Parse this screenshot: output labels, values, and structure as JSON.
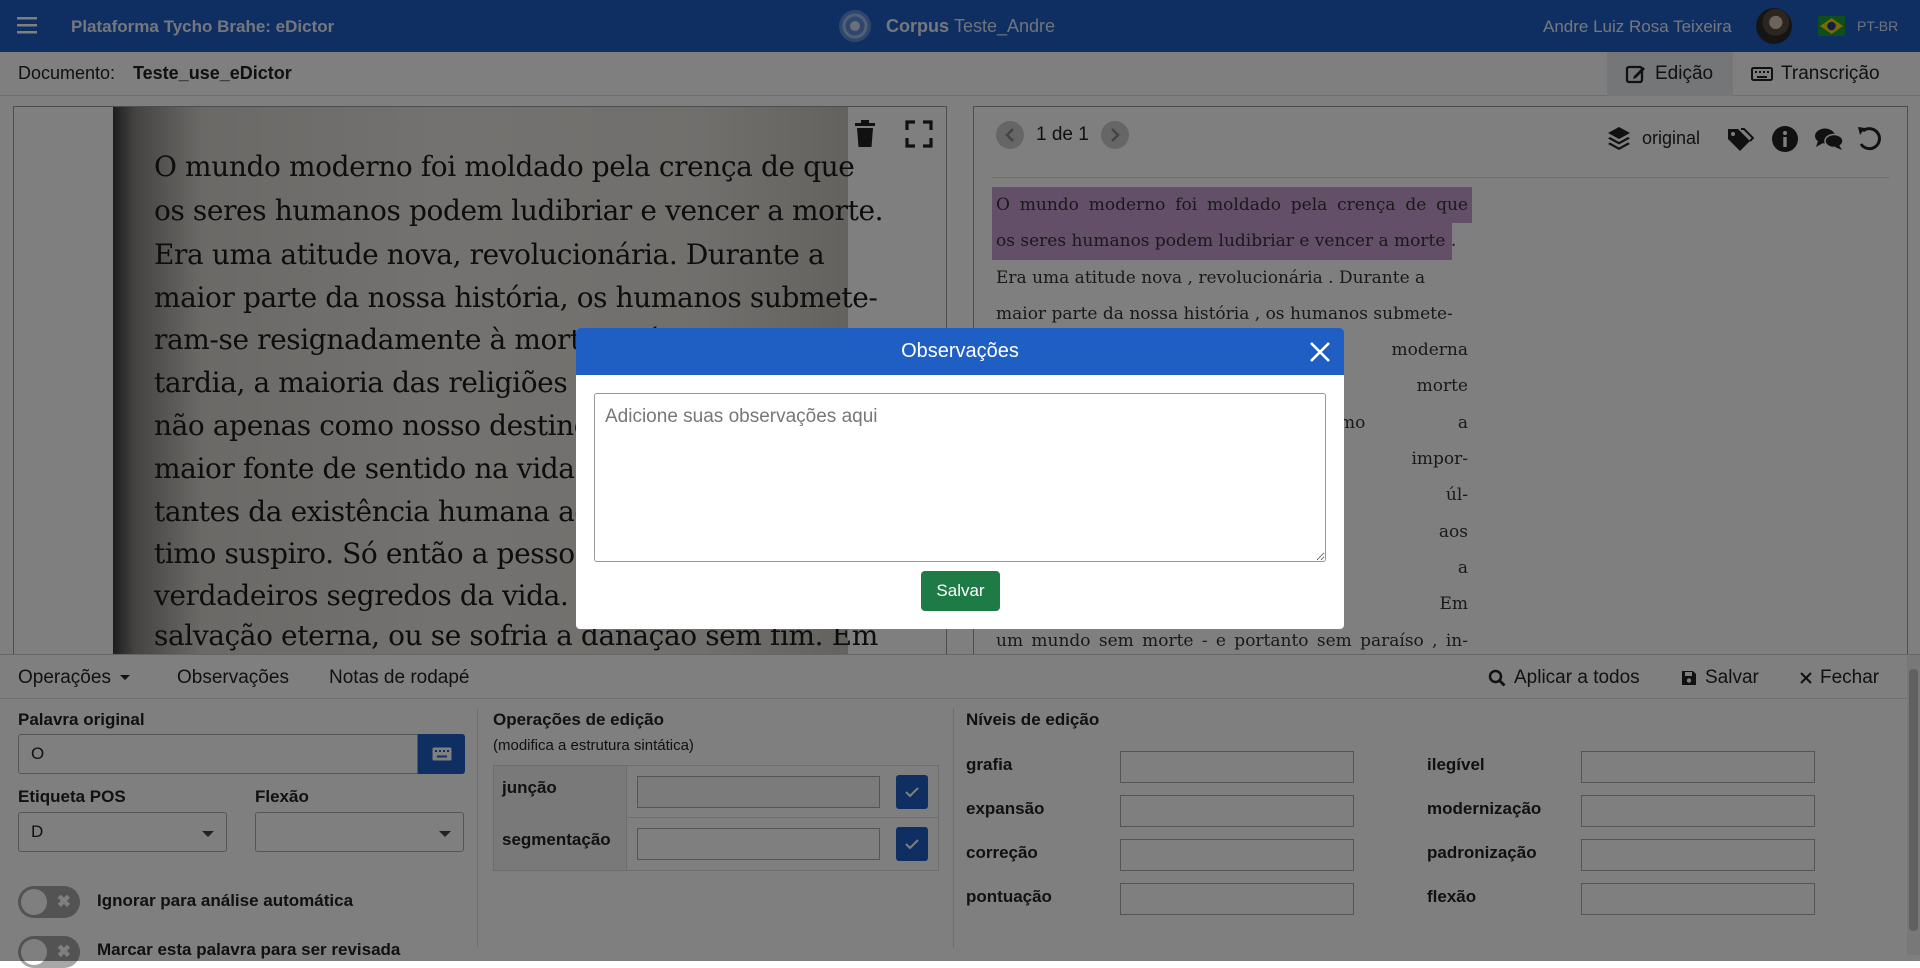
{
  "topbar": {
    "app_title": "Plataforma Tycho Brahe: eDictor",
    "corpus_label": "Corpus",
    "corpus_name": "Teste_Andre",
    "user_name": "Andre Luiz Rosa Teixeira",
    "language": "PT-BR",
    "colors": {
      "bar": "#1f5fc4",
      "flag": "#1c9b3a"
    }
  },
  "docbar": {
    "label": "Documento:",
    "doc_name": "Teste_use_eDictor",
    "tabs": [
      {
        "label": "Edição",
        "icon": "edit-icon",
        "active": true
      },
      {
        "label": "Transcrição",
        "icon": "keyboard-icon",
        "active": false
      }
    ]
  },
  "image_text": [
    "O mundo moderno foi moldado pela crença de que",
    "os seres humanos podem ludibriar e vencer a morte.",
    "Era uma atitude nova, revolucionária. Durante a",
    "maior parte da nossa história, os humanos submete-",
    "ram-se resignadamente à morte. Até",
    "tardia, a maioria das religiões e ideo",
    "não apenas como nosso destino inev",
    "maior fonte de sentido na vida. Os ev",
    "tantes da existência humana aconte",
    "timo suspiro. Só então a pessoa era",
    "verdadeiros segredos da vida. Só er",
    "salvação eterna, ou se sofria a danação sem fim. Em"
  ],
  "pager": {
    "text": "1 de 1"
  },
  "version_label": "original",
  "transcription": [
    "O mundo moderno foi moldado pela crença de que",
    "os seres humanos podem ludibriar e vencer a morte .",
    "Era uma atitude nova , revolucionária . Durante a",
    "maior parte da nossa história , os humanos submete-",
    "dade moderna",
    "as via a morte",
    "l , mas como a",
    "ntos mais impor-",
    "depois do úl-",
    "esentada aos",
    "se ganhava a",
    "sem fim . Em",
    "um mundo sem morte - e portanto sem paraíso , in-"
  ],
  "bottom_tabs": {
    "operations": "Operações",
    "observations": "Observações",
    "footnotes": "Notas de rodapé",
    "apply_all": "Aplicar a todos",
    "save": "Salvar",
    "close": "Fechar"
  },
  "word_panel": {
    "original_word_label": "Palavra original",
    "original_word_value": "O",
    "pos_label": "Etiqueta POS",
    "pos_value": "D",
    "inflection_label": "Flexão",
    "inflection_value": "",
    "ignore_label": "Ignorar para análise automática",
    "review_label": "Marcar esta palavra para ser revisada"
  },
  "edit_ops": {
    "title": "Operações de edição",
    "subtitle": "(modifica a estrutura sintática)",
    "rows": [
      "junção",
      "segmentação"
    ]
  },
  "levels": {
    "title": "Níveis de edição",
    "left": [
      "grafia",
      "expansão",
      "correção",
      "pontuação"
    ],
    "right": [
      "ilegível",
      "modernização",
      "padronização",
      "flexão"
    ]
  },
  "modal": {
    "title": "Observações",
    "placeholder": "Adicione suas observações aqui",
    "save": "Salvar",
    "colors": {
      "header": "#1f5fc4",
      "save": "#1e7b45"
    }
  },
  "highlight_color": "#c79fd0"
}
